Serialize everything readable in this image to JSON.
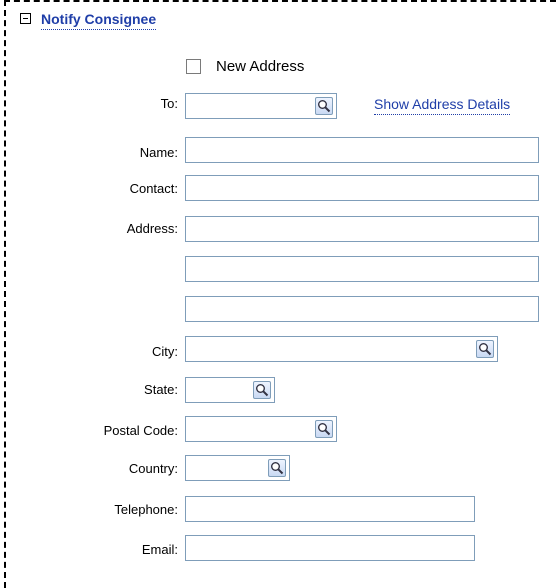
{
  "section": {
    "title": "Notify Consignee"
  },
  "new_address": {
    "label": "New Address",
    "checked": false
  },
  "show_address_link": "Show Address Details",
  "fields": {
    "to": {
      "label": "To:",
      "value": ""
    },
    "name": {
      "label": "Name:",
      "value": ""
    },
    "contact": {
      "label": "Contact:",
      "value": ""
    },
    "address": {
      "label": "Address:",
      "line1": "",
      "line2": "",
      "line3": ""
    },
    "city": {
      "label": "City:",
      "value": ""
    },
    "state": {
      "label": "State:",
      "value": ""
    },
    "postal_code": {
      "label": "Postal Code:",
      "value": ""
    },
    "country": {
      "label": "Country:",
      "value": ""
    },
    "telephone": {
      "label": "Telephone:",
      "value": ""
    },
    "email": {
      "label": "Email:",
      "value": ""
    }
  },
  "icons": {
    "lookup": "magnifier-icon",
    "collapse": "minus-box-icon"
  },
  "colors": {
    "link": "#1f3ea8",
    "field_border": "#7f9db9"
  }
}
